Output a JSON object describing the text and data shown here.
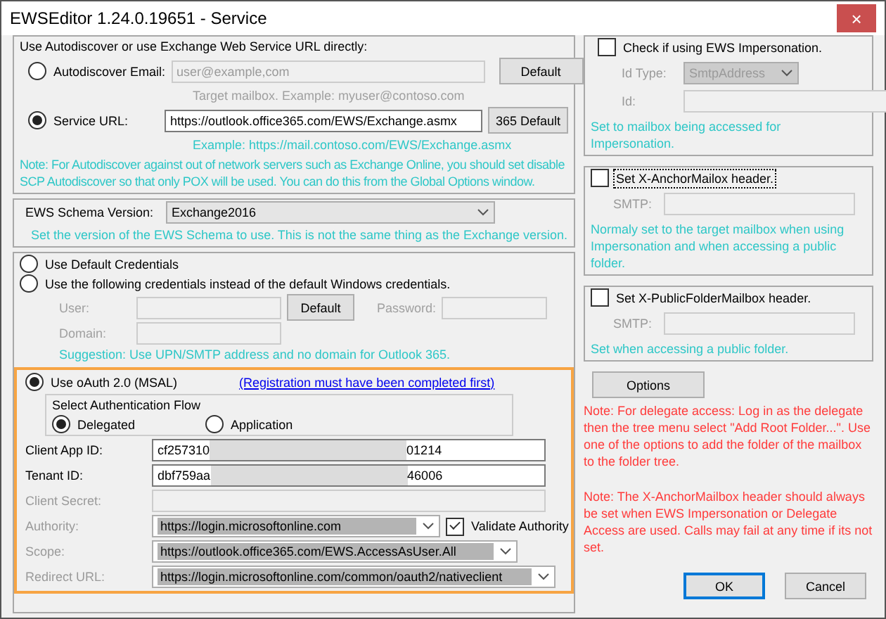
{
  "window": {
    "title": "EWSEditor 1.24.0.19651 - Service",
    "close": "×"
  },
  "endpoint": {
    "label": "Use Autodiscover or use Exchange Web Service URL directly:",
    "options": [
      {
        "kind": "email",
        "label": "Autodiscover Email:",
        "selected": false,
        "disabled": true,
        "value": "user@example,com",
        "hint": "Target mailbox.  Example: myuser@contoso.com",
        "button": "Default"
      },
      {
        "kind": "url",
        "label": "Service URL:",
        "selected": true,
        "disabled": false,
        "value": "https://outlook.office365.com/EWS/Exchange.asmx",
        "hint": "Example: https://mail.contoso.com/EWS/Exchange.asmx",
        "button": "365 Default"
      }
    ],
    "note": "Note: For Autodiscover against out of network servers such as Exchange Online, you should set disable SCP Autodiscover so that only POX will be used.  You can do this from the Global Options window."
  },
  "schema": {
    "label": "EWS Schema Version:",
    "value": "Exchange2016",
    "note": "Set the version of the EWS Schema to use.  This is not the same thing as the Exchange version."
  },
  "credentials": {
    "options": [
      {
        "label": "Use Default Credentials",
        "selected": false
      },
      {
        "label": "Use the following credentials instead of the default Windows credentials.",
        "selected": false
      }
    ],
    "user_label": "User:",
    "default_button": "Default",
    "password_label": "Password:",
    "domain_label": "Domain:",
    "suggestion": "Suggestion: Use UPN/SMTP address and no domain for Outlook 365."
  },
  "oauth": {
    "label": "Use oAuth 2.0 (MSAL)",
    "selected": true,
    "link": "(Registration must have been completed first)",
    "flow": {
      "legend": "Select Authentication Flow",
      "options": [
        {
          "label": "Delegated",
          "selected": true
        },
        {
          "label": "Application",
          "selected": false
        }
      ]
    },
    "fields": [
      {
        "kind": "text",
        "label": "Client App ID:",
        "disabled": false,
        "value": "cf257310",
        "value_end": "01214"
      },
      {
        "kind": "text",
        "label": "Tenant ID:",
        "disabled": false,
        "value": "dbf759aa",
        "value_end": "46006"
      },
      {
        "kind": "text",
        "label": "Client Secret:",
        "disabled": true
      },
      {
        "kind": "combo",
        "label": "Authority:",
        "disabled": true,
        "value": "https://login.microsoftonline.com",
        "check": {
          "label": "Validate Authority",
          "checked": true
        }
      },
      {
        "kind": "combo",
        "label": "Scope:",
        "disabled": true,
        "value": "https://outlook.office365.com/EWS.AccessAsUser.All"
      },
      {
        "kind": "combo",
        "label": "Redirect URL:",
        "disabled": true,
        "value": "https://login.microsoftonline.com/common/oauth2/nativeclient"
      }
    ]
  },
  "side_groups": [
    {
      "kind": "impersonation",
      "label": "Check if using EWS Impersonation.",
      "checked": false,
      "focused": false,
      "id_type_label": "Id Type:",
      "id_type": "SmtpAddress",
      "id_label": "Id:",
      "note": "Set to mailbox being accessed for Impersonation."
    },
    {
      "kind": "header",
      "label": "Set X-AnchorMailox header.",
      "checked": false,
      "focused": true,
      "smtp_label": "SMTP:",
      "note": "Normaly set to the target mailbox when using Impersonation and when accessing a public folder."
    },
    {
      "kind": "header",
      "label": "Set X-PublicFolderMailbox header.",
      "checked": false,
      "focused": false,
      "smtp_label": "SMTP:",
      "note": "Set when accessing a public folder."
    }
  ],
  "options_button": "Options",
  "notes": [
    "Note: For delegate access: Log in as the delegate then the tree menu select \"Add Root Folder...\".  Use one of the options to add the folder of the mailbox to the folder tree.",
    "Note: The X-AnchorMailbox header should always be set when EWS Impersonation or Delegate Access are used.  Calls may fail at any time if its not set."
  ],
  "buttons": [
    {
      "label": "OK",
      "default": true
    },
    {
      "label": "Cancel",
      "default": false
    }
  ]
}
